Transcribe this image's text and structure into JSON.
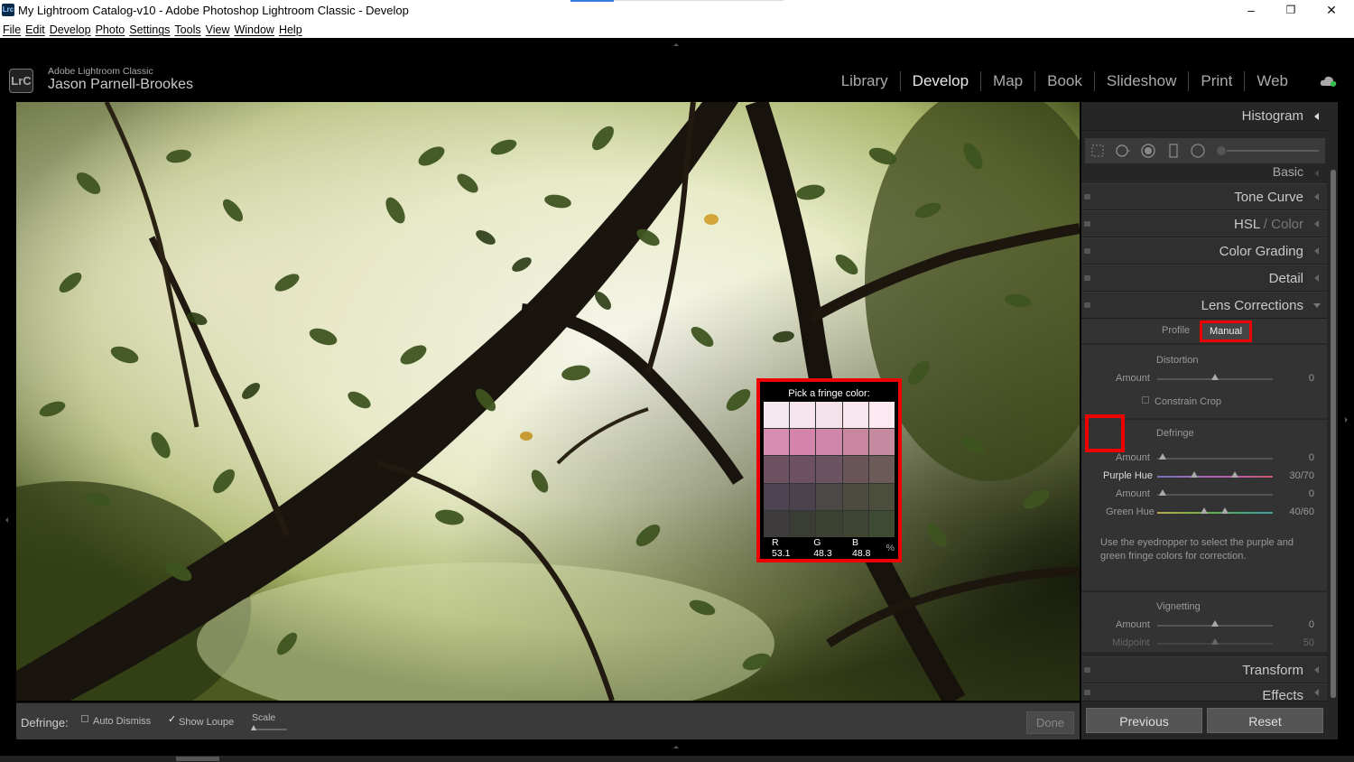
{
  "window": {
    "title": "My Lightroom Catalog-v10 - Adobe Photoshop Lightroom Classic - Develop",
    "app_icon_text": "Lrc",
    "controls": {
      "minimize": "–",
      "restore": "❐",
      "close": "✕"
    }
  },
  "menu": [
    "File",
    "Edit",
    "Develop",
    "Photo",
    "Settings",
    "Tools",
    "View",
    "Window",
    "Help"
  ],
  "identity": {
    "logo": "LrC",
    "product": "Adobe Lightroom Classic",
    "user": "Jason Parnell-Brookes"
  },
  "modules": [
    {
      "label": "Library",
      "active": false
    },
    {
      "label": "Develop",
      "active": true
    },
    {
      "label": "Map",
      "active": false
    },
    {
      "label": "Book",
      "active": false
    },
    {
      "label": "Slideshow",
      "active": false
    },
    {
      "label": "Print",
      "active": false
    },
    {
      "label": "Web",
      "active": false
    }
  ],
  "loupe": {
    "title": "Pick a fringe color:",
    "r_label": "R",
    "r": "53.1",
    "g_label": "G",
    "g": "48.3",
    "b_label": "B",
    "b": "48.8",
    "unit": "%",
    "swatches": [
      [
        "#f4e7ee",
        "#f6e5ef",
        "#f3e2ea",
        "#f7e6ee",
        "#fbe8f0"
      ],
      [
        "#d58eb1",
        "#d484ab",
        "#cf86a9",
        "#c9879f",
        "#c58a9f"
      ],
      [
        "#6e5262",
        "#6d5163",
        "#6b5361",
        "#6a5559",
        "#6b5a57"
      ],
      [
        "#4e4350",
        "#4b424d",
        "#4c4845",
        "#4d4b40",
        "#4b4e3b"
      ],
      [
        "#3d3b3c",
        "#393d34",
        "#3b4232",
        "#3e4633",
        "#3e4a31"
      ]
    ]
  },
  "toolbar": {
    "label": "Defringe:",
    "auto_dismiss": "Auto Dismiss",
    "show_loupe": "Show Loupe",
    "scale": "Scale",
    "done": "Done",
    "check_mark": "✓"
  },
  "panel": {
    "histogram": "Histogram",
    "basic": "Basic",
    "tone_curve": "Tone Curve",
    "hsl": "HSL",
    "hsl_sep": "/",
    "color": "Color",
    "color_grading": "Color Grading",
    "detail": "Detail",
    "lens_corrections": "Lens Corrections",
    "tab_profile": "Profile",
    "tab_manual": "Manual",
    "distortion": {
      "heading": "Distortion",
      "amount_label": "Amount",
      "amount_value": "0",
      "amount_level": 0.5,
      "constrain_crop": "Constrain Crop"
    },
    "defringe": {
      "heading": "Defringe",
      "purple_amount_label": "Amount",
      "purple_amount_value": "0",
      "purple_amount_level": 0.0,
      "purple_hue_label": "Purple Hue",
      "purple_hue_value": "30/70",
      "purple_hue_range": [
        30,
        70
      ],
      "green_amount_label": "Amount",
      "green_amount_value": "0",
      "green_amount_level": 0.0,
      "green_hue_label": "Green Hue",
      "green_hue_value": "40/60",
      "green_hue_range": [
        40,
        60
      ],
      "help": "Use the eyedropper to select the purple and green fringe colors for correction."
    },
    "vignetting": {
      "heading": "Vignetting",
      "amount_label": "Amount",
      "amount_value": "0",
      "amount_level": 0.5,
      "midpoint_label": "Midpoint",
      "midpoint_value": "50",
      "midpoint_level": 0.5
    },
    "transform": "Transform",
    "effects": "Effects",
    "previous": "Previous",
    "reset": "Reset"
  },
  "colors": {
    "highlight": "#e00000",
    "panel_bg": "#262626",
    "accent_red": "#d00000"
  }
}
